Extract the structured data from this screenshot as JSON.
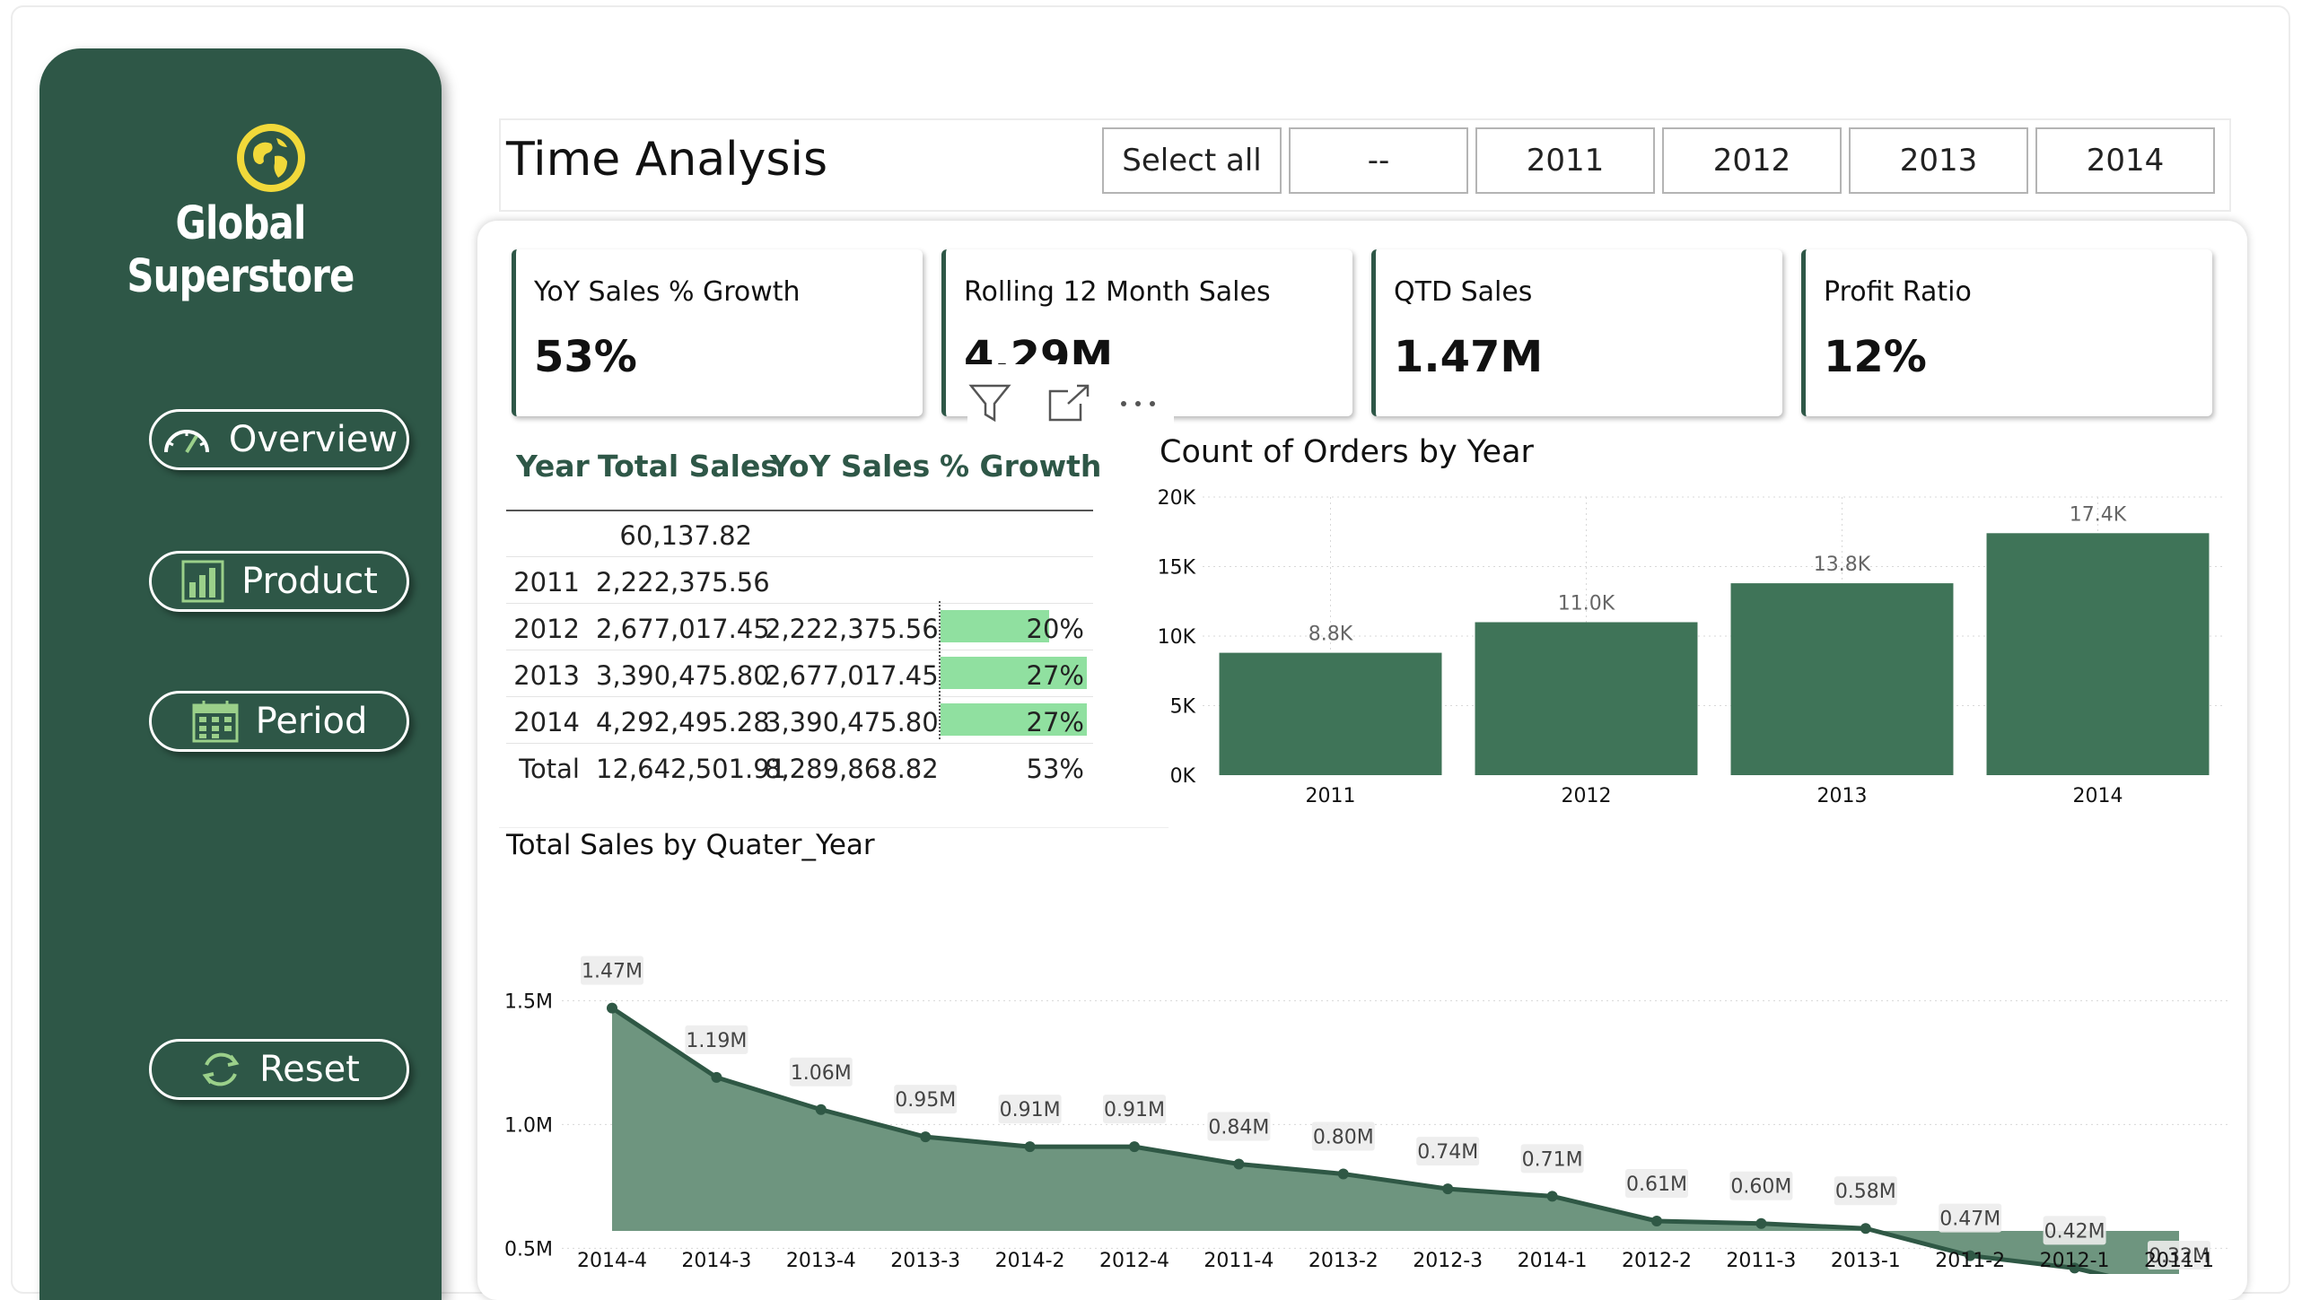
{
  "brand": {
    "name": "Global Superstore"
  },
  "nav": {
    "overview": "Overview",
    "product": "Product",
    "period": "Period",
    "reset": "Reset"
  },
  "header": {
    "title": "Time Analysis",
    "slicers": [
      "Select all",
      "--",
      "2011",
      "2012",
      "2013",
      "2014"
    ]
  },
  "kpis": [
    {
      "label": "YoY Sales % Growth",
      "value": "53%"
    },
    {
      "label": "Rolling 12 Month Sales",
      "value": "4.29M"
    },
    {
      "label": "QTD Sales",
      "value": "1.47M"
    },
    {
      "label": "Profit Ratio",
      "value": "12%"
    }
  ],
  "table": {
    "headers": [
      "Year",
      "Total Sales",
      "YoY Sales",
      "% Growth"
    ],
    "rows": [
      {
        "year": "",
        "total": "60,137.82",
        "yoy": "",
        "growth": "",
        "growth_value": 0
      },
      {
        "year": "2011",
        "total": "2,222,375.56",
        "yoy": "",
        "growth": "",
        "growth_value": 0
      },
      {
        "year": "2012",
        "total": "2,677,017.45",
        "yoy": "2,222,375.56",
        "growth": "20%",
        "growth_value": 20
      },
      {
        "year": "2013",
        "total": "3,390,475.80",
        "yoy": "2,677,017.45",
        "growth": "27%",
        "growth_value": 27
      },
      {
        "year": "2014",
        "total": "4,292,495.28",
        "yoy": "3,390,475.80",
        "growth": "27%",
        "growth_value": 27
      }
    ],
    "total_row": {
      "label": "Total",
      "total": "12,642,501.91",
      "yoy": "8,289,868.82",
      "growth": "53%"
    },
    "growth_bar_color": "#90e0a0"
  },
  "chart_data": [
    {
      "type": "bar",
      "title": "Count of Orders by Year",
      "categories": [
        "2011",
        "2012",
        "2013",
        "2014"
      ],
      "values": [
        8800,
        11000,
        13800,
        17400
      ],
      "data_labels": [
        "8.8K",
        "11.0K",
        "13.8K",
        "17.4K"
      ],
      "y_ticks": [
        "0K",
        "5K",
        "10K",
        "15K",
        "20K"
      ],
      "ylim": [
        0,
        20000
      ],
      "color": "#3f7458",
      "grid": true
    },
    {
      "type": "area",
      "title": "Total Sales by Quater_Year",
      "categories": [
        "2014-4",
        "2014-3",
        "2013-4",
        "2013-3",
        "2014-2",
        "2012-4",
        "2011-4",
        "2013-2",
        "2012-3",
        "2014-1",
        "2012-2",
        "2011-3",
        "2013-1",
        "2011-2",
        "2012-1",
        "2011-1"
      ],
      "values": [
        1.47,
        1.19,
        1.06,
        0.95,
        0.91,
        0.91,
        0.84,
        0.8,
        0.74,
        0.71,
        0.61,
        0.6,
        0.58,
        0.47,
        0.42,
        0.32
      ],
      "data_labels": [
        "1.47M",
        "1.19M",
        "1.06M",
        "0.95M",
        "0.91M",
        "0.91M",
        "0.84M",
        "0.80M",
        "0.74M",
        "0.71M",
        "0.61M",
        "0.60M",
        "0.58M",
        "0.47M",
        "0.42M",
        "0.32M"
      ],
      "y_ticks": [
        "0.5M",
        "1.0M",
        "1.5M"
      ],
      "ylim": [
        0,
        1.5
      ],
      "line_color": "#2f5845",
      "fill_color": "#6e957f",
      "grid": true
    }
  ],
  "colors": {
    "sidebar": "#2e5747",
    "accent": "#2e5747",
    "logo": "#f1d93a"
  },
  "icons": {
    "logo": "globe-icon",
    "overview": "gauge-icon",
    "product": "bar-chart-icon",
    "period": "calendar-icon",
    "reset": "refresh-icon"
  }
}
